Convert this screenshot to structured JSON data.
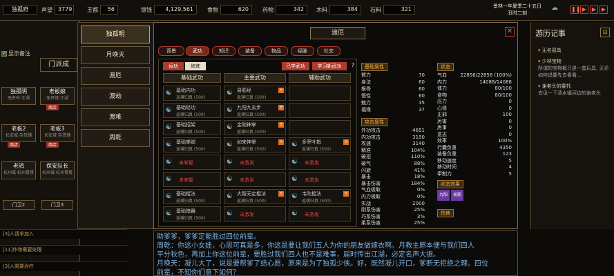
{
  "top": {
    "location": "独孤府",
    "prestige_label": "声望",
    "prestige_value": "3779",
    "kingli_label": "王都",
    "kingli_value": "56",
    "silver_label": "银钱",
    "silver_value": "4,129,561",
    "food_label": "食物",
    "food_value": "620",
    "herb_label": "药物",
    "herb_value": "342",
    "wood_label": "木料",
    "wood_value": "384",
    "stone_label": "石料",
    "stone_value": "321",
    "date": "景林一年夏季二十五日",
    "time": "丑时二刻"
  },
  "left": {
    "show_notes": "显示备注",
    "sect": "门派成",
    "cards": [
      {
        "name": "独孤明",
        "sub": "无名岳·江湖"
      },
      {
        "name": "老板娘",
        "sub": "无名镇·江湖",
        "badge": "商店"
      },
      {
        "name": "老板2",
        "sub": "长安城·杂货铺",
        "badge": "商店"
      },
      {
        "name": "老板3",
        "sub": "长安城·杂货铺",
        "badge": "商店"
      },
      {
        "name": "老鸨",
        "sub": "杭州城·杭州青楼"
      },
      {
        "name": "保安队长",
        "sub": "杭州城·杭州青楼"
      }
    ],
    "gates": [
      "门卫2",
      "门卫3"
    ],
    "tasks": [
      "[3]人请求加入",
      "[11]作物需要处理",
      "[3]人需要治疗"
    ]
  },
  "nav": [
    "独孤明",
    "月唤天",
    "渡厄",
    "渡劫",
    "渡难",
    "周乾"
  ],
  "main": {
    "title": "渡厄",
    "tabs": [
      "背景",
      "武功",
      "知识",
      "装备",
      "物品",
      "经脉",
      "社交"
    ],
    "subtabs": [
      "运功",
      "修炼"
    ],
    "buttons": [
      "已学武功",
      "学习新武功"
    ],
    "help": "?",
    "col_headers": [
      "基础武功",
      "主要武功",
      "辅助武功"
    ],
    "base_skills": [
      {
        "name": "基础内功",
        "sub": "返璞归真 (500)"
      },
      {
        "name": "基础轻功",
        "sub": "返璞归真 (500)"
      },
      {
        "name": "基础招架",
        "sub": "返璞归真 (500)"
      },
      {
        "name": "基础拳脚",
        "sub": "返璞归真 (500)"
      },
      {
        "name": "未掌握",
        "sub": ""
      },
      {
        "name": "未掌握",
        "sub": ""
      },
      {
        "name": "基础棍法",
        "sub": "返璞归真 (500)"
      },
      {
        "name": "基础暗器",
        "sub": "返璞归真 (500)"
      }
    ],
    "main_skills": [
      {
        "name": "易筋经",
        "sub": "返璞归真 (500)"
      },
      {
        "name": "九阳九玄步",
        "sub": "返璞归真 (500)"
      },
      {
        "name": "金刚神掌",
        "sub": "返璞归真 (500)"
      },
      {
        "name": "如来神掌",
        "sub": "返璞归真 (500)"
      },
      {
        "name": "未激发",
        "sub": ""
      },
      {
        "name": "未激发",
        "sub": ""
      },
      {
        "name": "大智无定棍法",
        "sub": "返璞归真 (500)"
      },
      {
        "name": "未激发",
        "sub": ""
      }
    ],
    "aux_skills": [
      {
        "name": "",
        "sub": ""
      },
      {
        "name": "",
        "sub": ""
      },
      {
        "name": "",
        "sub": ""
      },
      {
        "name": "多罗叶指",
        "sub": "返璞归真 (500)"
      },
      {
        "name": "未激发",
        "sub": ""
      },
      {
        "name": "未激发",
        "sub": ""
      },
      {
        "name": "韦陀棍法",
        "sub": "返璞归真 (500)"
      },
      {
        "name": "未激发",
        "sub": ""
      }
    ],
    "base_attr_title": "基础属性",
    "base_attrs": [
      [
        "臂力",
        "70"
      ],
      [
        "身法",
        "60"
      ],
      [
        "根骨",
        "60"
      ],
      [
        "悟性",
        "60"
      ],
      [
        "魅力",
        "35"
      ],
      [
        "福缘",
        "37"
      ]
    ],
    "atk_attr_title": "攻击属性",
    "atk_attrs": [
      [
        "外功攻击",
        "4651"
      ],
      [
        "内功攻击",
        "3190"
      ],
      [
        "攻速",
        "3140"
      ],
      [
        "精准",
        "104%"
      ],
      [
        "破招",
        "110%"
      ],
      [
        "破气",
        "88%"
      ],
      [
        "闪避",
        "41%"
      ],
      [
        "暴击",
        "18%"
      ],
      [
        "暴击伤害",
        "184%"
      ],
      [
        "气血吸取",
        "0%"
      ],
      [
        "内力吸取",
        "0%"
      ],
      [
        "实战",
        "2000"
      ],
      [
        "刚系伤害",
        "25%"
      ],
      [
        "巧系伤害",
        "3%"
      ],
      [
        "柔系伤害",
        "25%"
      ]
    ],
    "status_title": "状态",
    "status": [
      [
        "气血",
        "22856/22856 (100%)"
      ],
      [
        "内力",
        "14088/14088"
      ],
      [
        "体力",
        "80/100"
      ],
      [
        "食物",
        "80/100"
      ],
      [
        "压力",
        "0"
      ],
      [
        "心情",
        "0"
      ],
      [
        "正邪",
        "100"
      ],
      [
        "厉害",
        "0"
      ],
      [
        "房事",
        "0"
      ],
      [
        "意志",
        "0"
      ],
      [
        "效率",
        "100%"
      ],
      [
        "行囊负重",
        "4350"
      ],
      [
        "装备负重",
        "123"
      ],
      [
        "移动速度",
        "5"
      ],
      [
        "移动时间",
        "4"
      ],
      [
        "牵制力",
        "5"
      ]
    ],
    "effects_title": "状态效果",
    "effects": [
      "九阳",
      "易筋"
    ],
    "injury_title": "伤病"
  },
  "right": {
    "title": "游历记事",
    "entries": [
      {
        "head": "无名孤岛",
        "body": ""
      },
      {
        "head": "少林宝物",
        "body": "所谓的宝物概只是一盒玩具, 无论如何说要先去看看..."
      },
      {
        "head": "谢老头的委托",
        "body": "去见一下清水镇河边的谢老头"
      }
    ]
  },
  "dialog": [
    "助爹爹，爹爹定能胜过四位前辈。",
    "周乾：你这小女娃，心思可真是多，你这是要让我们五人为你的朋友做嫁衣啊。月教主原本便与我们四人",
    "平分秋色，再加上你这位前辈，要胜过我们四人也不是难事，届时传出江湖，必定名声大振。",
    "月唤天：凝儿大了，说是要帮爹了结心愿，原来是为了独孤少侠。好，既然凝儿开口，爹断无拒绝之理。四位",
    "前辈，不知你们意下如何？"
  ]
}
